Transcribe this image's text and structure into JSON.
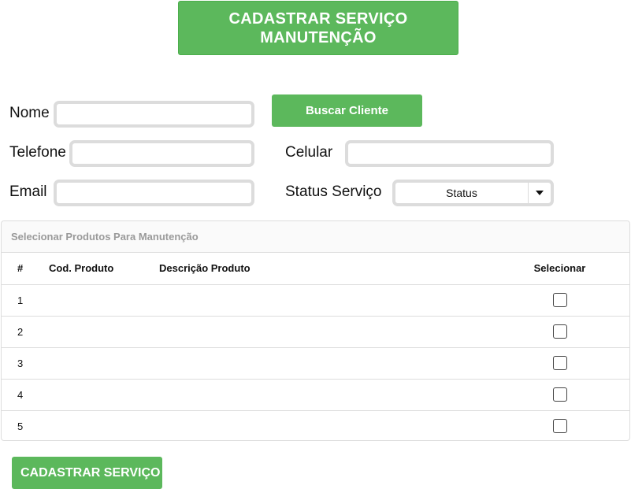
{
  "header": {
    "title_line1": "CADASTRAR SERVIÇO",
    "title_line2": "MANUTENÇÃO"
  },
  "form": {
    "nome_label": "Nome",
    "nome_value": "",
    "buscar_label": "Buscar Cliente",
    "telefone_label": "Telefone",
    "telefone_value": "",
    "celular_label": "Celular",
    "celular_value": "",
    "email_label": "Email",
    "email_value": "",
    "status_label": "Status Serviço",
    "status_selected": "Status"
  },
  "products": {
    "panel_title": "Selecionar Produtos Para Manutenção",
    "columns": [
      "#",
      "Cod. Produto",
      "Descrição Produto",
      "Selecionar"
    ],
    "rows": [
      {
        "num": "1",
        "cod": "",
        "desc": "",
        "checked": false
      },
      {
        "num": "2",
        "cod": "",
        "desc": "",
        "checked": false
      },
      {
        "num": "3",
        "cod": "",
        "desc": "",
        "checked": false
      },
      {
        "num": "4",
        "cod": "",
        "desc": "",
        "checked": false
      },
      {
        "num": "5",
        "cod": "",
        "desc": "",
        "checked": false
      }
    ]
  },
  "submit": {
    "label": "CADASTRAR SERVIÇO"
  },
  "colors": {
    "accent_green": "#5cb85c",
    "field_border": "#dcdcdc",
    "panel_title_gray": "#9a9a9a"
  },
  "icons": {
    "select_arrow": "caret-down-icon"
  }
}
